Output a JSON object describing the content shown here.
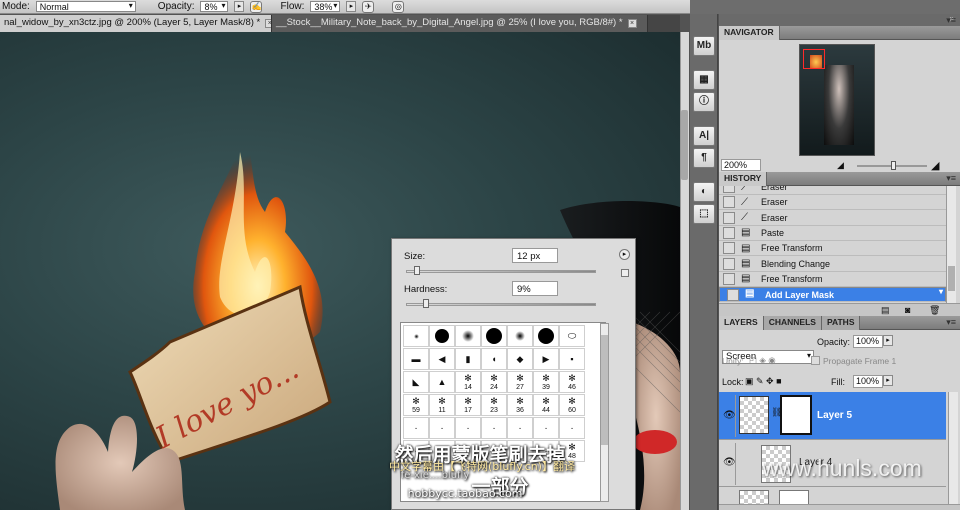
{
  "options_bar": {
    "mode_label": "Mode:",
    "mode_value": "Normal",
    "opacity_label": "Opacity:",
    "opacity_value": "8%",
    "flow_label": "Flow:",
    "flow_value": "38%"
  },
  "tabs": [
    {
      "label": "nal_widow_by_xn3ctz.jpg @ 200% (Layer 5, Layer Mask/8) *",
      "active": true
    },
    {
      "label": "__Stock__Military_Note_back_by_Digital_Angel.jpg @ 25% (I love you, RGB/8#) *",
      "active": false
    }
  ],
  "canvas": {
    "note_text": "I love yo..."
  },
  "brush_picker": {
    "size_label": "Size:",
    "size_value": "12 px",
    "hardness_label": "Hardness:",
    "hardness_value": "9%",
    "size_fraction": 0.04,
    "hardness_fraction": 0.09,
    "brush_numbers": [
      "14",
      "24",
      "27",
      "39",
      "46",
      "59",
      "11",
      "17",
      "23",
      "36",
      "44",
      "60",
      "48"
    ]
  },
  "navigator": {
    "title": "NAVIGATOR",
    "zoom_value": "200%"
  },
  "history": {
    "title": "HISTORY",
    "items": [
      "Eraser",
      "Eraser",
      "Eraser",
      "Paste",
      "Free Transform",
      "Blending Change",
      "Free Transform",
      "Add Layer Mask"
    ],
    "selected_index": 7
  },
  "layers": {
    "tabs": [
      "LAYERS",
      "CHANNELS",
      "PATHS"
    ],
    "blend_mode": "Screen",
    "opacity_label": "Opacity:",
    "opacity_value": "100%",
    "unify_label": "Unify:",
    "propagate_label": "Propagate Frame 1",
    "lock_label": "Lock:",
    "fill_label": "Fill:",
    "fill_value": "100%",
    "items": [
      {
        "name": "Layer 5",
        "selected": true
      },
      {
        "name": "Layer 4",
        "selected": false
      }
    ]
  },
  "subtitles": {
    "line1": "然后用蒙版笔刷去掉",
    "line2": "中文字幕由【飞特网(blufly.cn)】翻译",
    "line3": "一部分",
    "line4": "fe-xie....blufly",
    "line5": "hobbycc.taobao.com"
  },
  "watermark": "www.hunls.com",
  "colors": {
    "selection_blue": "#3b80e6",
    "panel_gray": "#d4d4d4"
  }
}
